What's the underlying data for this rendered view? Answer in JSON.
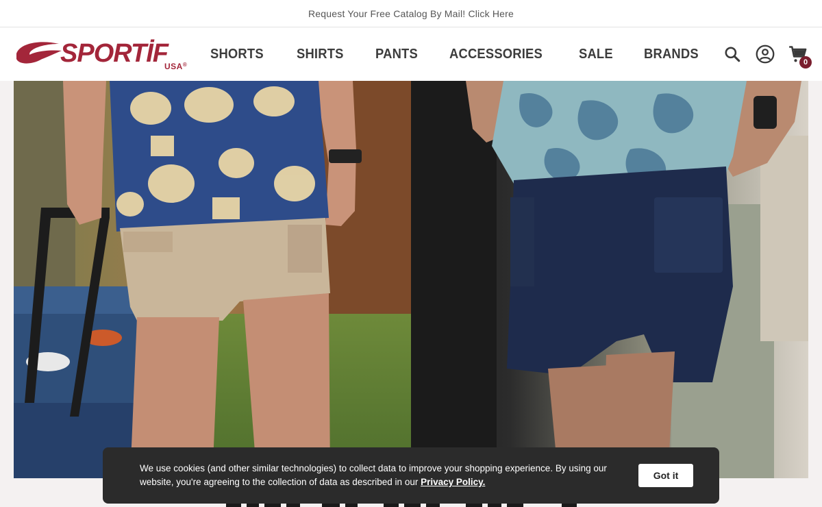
{
  "announcement": {
    "text": "Request Your Free Catalog By Mail! Click Here"
  },
  "brand": {
    "name": "SPORTİF",
    "sub": "USA",
    "reg": "®",
    "color": "#a3263a"
  },
  "nav": {
    "items": [
      {
        "label": "SHORTS"
      },
      {
        "label": "SHIRTS"
      },
      {
        "label": "PANTS"
      },
      {
        "label": "ACCESSORIES"
      },
      {
        "label": "SALE"
      },
      {
        "label": "BRANDS"
      }
    ]
  },
  "header_icons": {
    "search": "search-icon",
    "account": "account-icon",
    "cart": "cart-icon",
    "cart_count": "0"
  },
  "hero": {
    "left": {
      "description_icon": "photo-man-khaki-shorts-hawaiian-shirt-cooler"
    },
    "right": {
      "description_icon": "photo-man-navy-shorts-teal-print-shirt"
    }
  },
  "cookie": {
    "text": "We use cookies (and other similar technologies) to collect data to improve your shopping experience. By using our website, you're agreeing to the collection of data as described in our",
    "link_label": "Privacy Policy.",
    "button_label": "Got it"
  },
  "colors": {
    "accent": "#a3263a",
    "cookie_bg": "#2b2b2b",
    "badge": "#7a1e2e"
  }
}
